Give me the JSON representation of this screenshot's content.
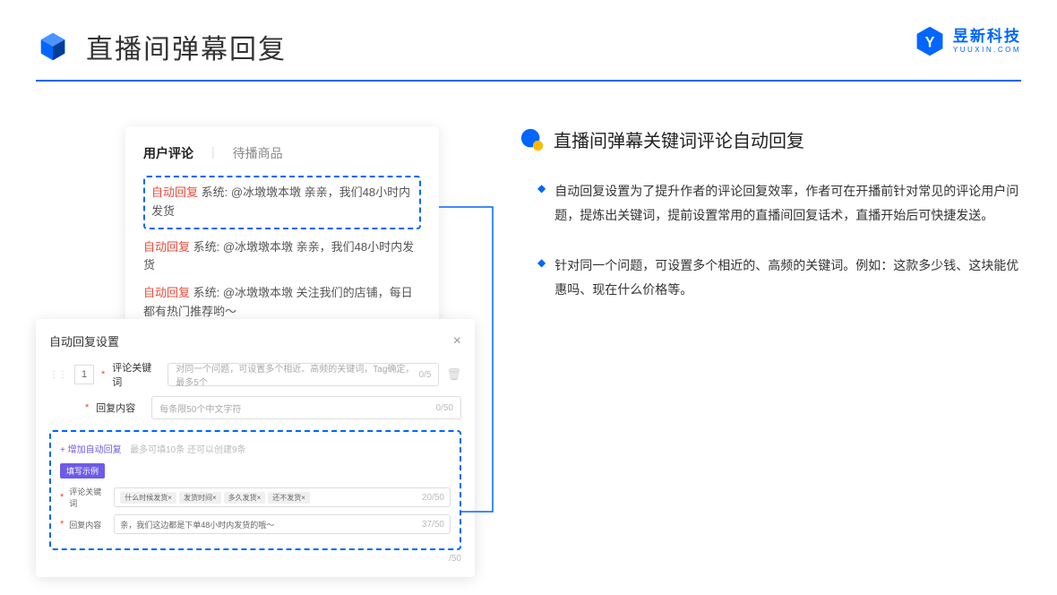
{
  "header": {
    "title": "直播间弹幕回复"
  },
  "brand": {
    "cn": "昱新科技",
    "en": "YUUXIN.COM"
  },
  "panel1": {
    "tabs": {
      "active": "用户评论",
      "inactive": "待播商品"
    },
    "hl_prefix": "自动回复",
    "hl_sys": " 系统: ",
    "hl_rest": "@冰墩墩本墩 亲亲，我们48小时内发货",
    "c2_prefix": "自动回复",
    "c2_rest": " 系统: @冰墩墩本墩 亲亲，我们48小时内发货",
    "c3_prefix": "自动回复",
    "c3_rest": " 系统: @冰墩墩本墩 关注我们的店铺，每日都有热门推荐哟～"
  },
  "panel2": {
    "title": "自动回复设置",
    "idx": "1",
    "label_kw": "评论关键词",
    "ph_kw": "对同一个问题，可设置多个相近、高频的关键词，Tag确定，最多5个",
    "count_kw": "0/5",
    "label_content": "回复内容",
    "ph_content": "每条限50个中文字符",
    "count_content": "0/50",
    "add_text": "+ 增加自动回复",
    "add_hint": "最多可填10条 还可以创建9条",
    "ex_badge": "填写示例",
    "ex_kw_label": "评论关键词",
    "ex_tags": {
      "t1": "什么时候发货×",
      "t2": "发货时间×",
      "t3": "多久发货×",
      "t4": "还不发货×"
    },
    "ex_kw_count": "20/50",
    "ex_ct_label": "回复内容",
    "ex_ct_val": "亲，我们这边都是下单48小时内发货的哦～",
    "ex_ct_count": "37/50",
    "outer_count": "/50"
  },
  "right": {
    "subtitle": "直播间弹幕关键词评论自动回复",
    "b1": "自动回复设置为了提升作者的评论回复效率，作者可在开播前针对常见的评论用户问题，提炼出关键词，提前设置常用的直播间回复话术，直播开始后可快捷发送。",
    "b2": "针对同一个问题，可设置多个相近的、高频的关键词。例如：这款多少钱、这块能优惠吗、现在什么价格等。"
  }
}
